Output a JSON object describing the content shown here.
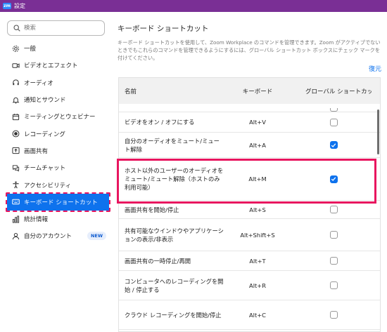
{
  "window": {
    "title": "設定",
    "logo_text": "zm"
  },
  "search": {
    "placeholder": "検索"
  },
  "sidebar": {
    "items": [
      {
        "label": "一般",
        "icon": "gear-icon"
      },
      {
        "label": "ビデオとエフェクト",
        "icon": "video-camera-icon"
      },
      {
        "label": "オーディオ",
        "icon": "headphones-icon"
      },
      {
        "label": "通知とサウンド",
        "icon": "bell-icon"
      },
      {
        "label": "ミーティングとウェビナー",
        "icon": "calendar-icon"
      },
      {
        "label": "レコーディング",
        "icon": "record-icon"
      },
      {
        "label": "画面共有",
        "icon": "share-screen-icon"
      },
      {
        "label": "チームチャット",
        "icon": "chat-icon"
      },
      {
        "label": "アクセシビリティ",
        "icon": "accessibility-icon"
      },
      {
        "label": "キーボード ショートカット",
        "icon": "keyboard-icon",
        "active": true
      },
      {
        "label": "統計情報",
        "icon": "statistics-icon"
      },
      {
        "label": "自分のアカウント",
        "icon": "person-icon",
        "badge": "NEW"
      }
    ]
  },
  "main": {
    "title": "キーボード ショートカット",
    "description": "キーボード ショートカットを使用して、Zoom Workplace のコマンドを管理できます。Zoom がアクティブでないときでもこれらのコマンドを管理できるようにするには、グローバル ショートカット ボックスにチェック マークを付けてください。",
    "restore_label": "復元",
    "columns": {
      "name": "名前",
      "keys": "キーボード",
      "global": "グローバル ショートカット"
    },
    "rows": [
      {
        "name": "",
        "keys": "",
        "global": false
      },
      {
        "name": "ビデオをオン / オフにする",
        "keys": "Alt+V",
        "global": false
      },
      {
        "name": "自分のオーディオをミュート/ミュート解除",
        "keys": "Alt+A",
        "global": true
      },
      {
        "name": "ホスト以外のユーザーのオーディオをミュート/ミュート解除（ホストのみ利用可能）",
        "keys": "Alt+M",
        "global": true
      },
      {
        "name": "画面共有を開始/停止",
        "keys": "Alt+S",
        "global": false
      },
      {
        "name": "共有可能なウインドウやアプリケーションの表示/非表示",
        "keys": "Alt+Shift+S",
        "global": false
      },
      {
        "name": "画面共有の一時停止/再開",
        "keys": "Alt+T",
        "global": false
      },
      {
        "name": "コンピュータへのレコーディングを開始 / 停止する",
        "keys": "Alt+R",
        "global": false
      },
      {
        "name": "クラウド レコーディングを開始/停止",
        "keys": "Alt+C",
        "global": false
      }
    ]
  },
  "colors": {
    "titlebar": "#7a2f95",
    "accent": "#0e72ed",
    "highlight": "#e8165f"
  }
}
